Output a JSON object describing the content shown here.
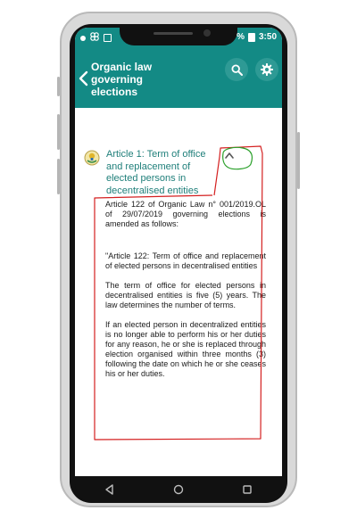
{
  "statusbar": {
    "time": "3:50",
    "battery_text": "%",
    "icons": [
      "notification-icon",
      "pinwheel-icon",
      "image-icon",
      "battery-icon"
    ]
  },
  "appbar": {
    "title": "Organic law governing elections",
    "back_icon": "chevron-left-icon",
    "search_icon": "search-icon",
    "settings_icon": "gear-icon"
  },
  "article": {
    "title": "Article 1: Term of office and replacement of elected persons in decentralised entities",
    "logo_icon": "emblem-icon",
    "toggle_icon": "chevron-up-icon",
    "paragraphs": [
      "Article 122 of Organic Law n° 001/2019.OL of 29/07/2019 governing elections is amended as follows:",
      "\"Article 122: Term of office and replacement of elected persons in decentralised entities",
      "The term of office for elected persons in decentralised entities is five (5) years. The law determines the number of terms.",
      "If an elected person in decentralized entities is no longer able to perform his or her duties for any reason, he or she is replaced through election organised within three months (3) following the date on which he or she ceases his or her duties."
    ]
  },
  "navbar": {
    "icons": [
      "back-triangle-icon",
      "home-circle-icon",
      "recents-square-icon"
    ]
  },
  "colors": {
    "primary": "#138a85",
    "title_text": "#1f7f7a",
    "annotation_red": "#d42020",
    "annotation_green": "#2aa02a"
  }
}
